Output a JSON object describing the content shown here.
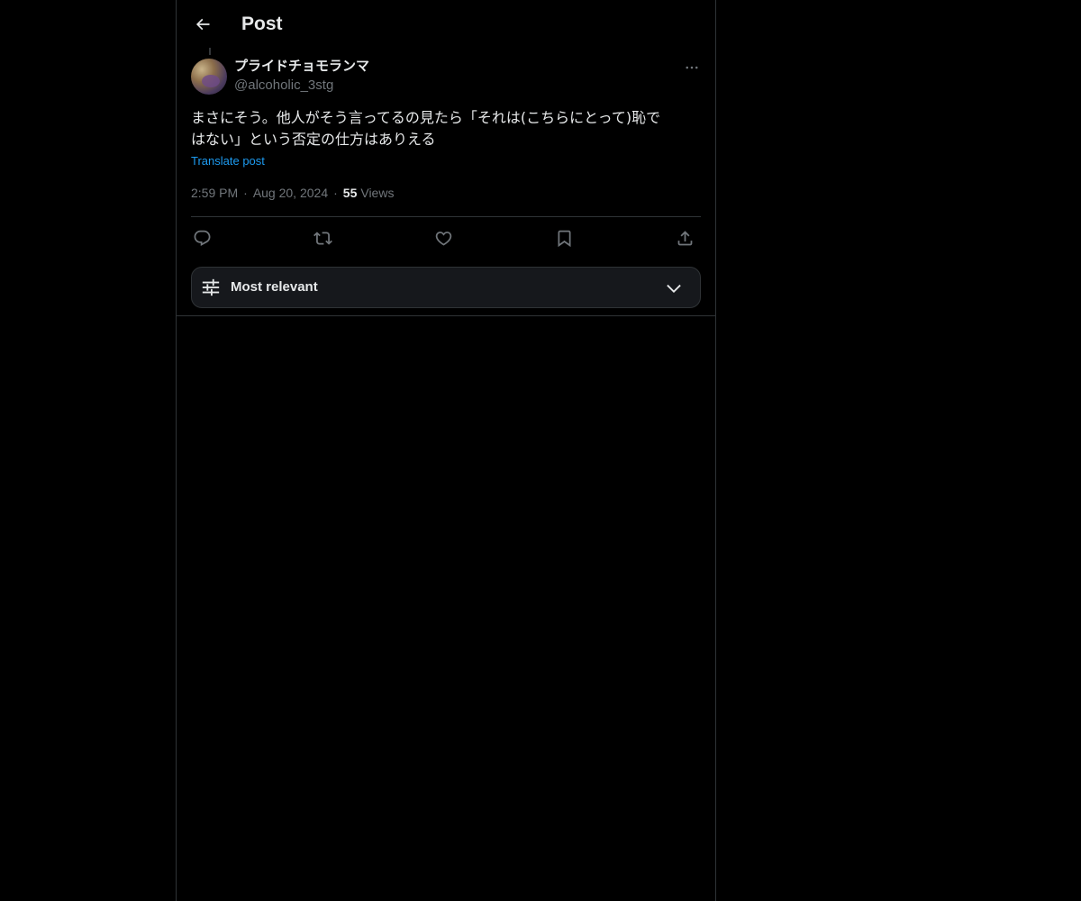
{
  "header": {
    "title": "Post",
    "back_icon": "arrow-left-icon"
  },
  "post": {
    "author": {
      "display_name": "プライドチョモランマ",
      "handle": "@alcoholic_3stg",
      "avatar": "avatar-image"
    },
    "text": "まさにそう。他人がそう言ってるの見たら「それは(こちらにとって)恥で\nはない」という否定の仕方はありえる",
    "translate_label": "Translate post",
    "time": "2:59 PM",
    "date": "Aug 20, 2024",
    "separator": "·",
    "views_count": "55",
    "views_label": "Views"
  },
  "actions": [
    {
      "name": "reply-icon"
    },
    {
      "name": "repost-icon"
    },
    {
      "name": "like-icon"
    },
    {
      "name": "bookmark-icon"
    },
    {
      "name": "share-icon"
    }
  ],
  "sort": {
    "label": "Most relevant",
    "icon": "sliders-icon",
    "chevron": "chevron-down-icon"
  },
  "colors": {
    "background": "#000000",
    "text": "#e7e9ea",
    "muted": "#71767b",
    "link": "#1d9bf0",
    "border": "#2f3336"
  }
}
